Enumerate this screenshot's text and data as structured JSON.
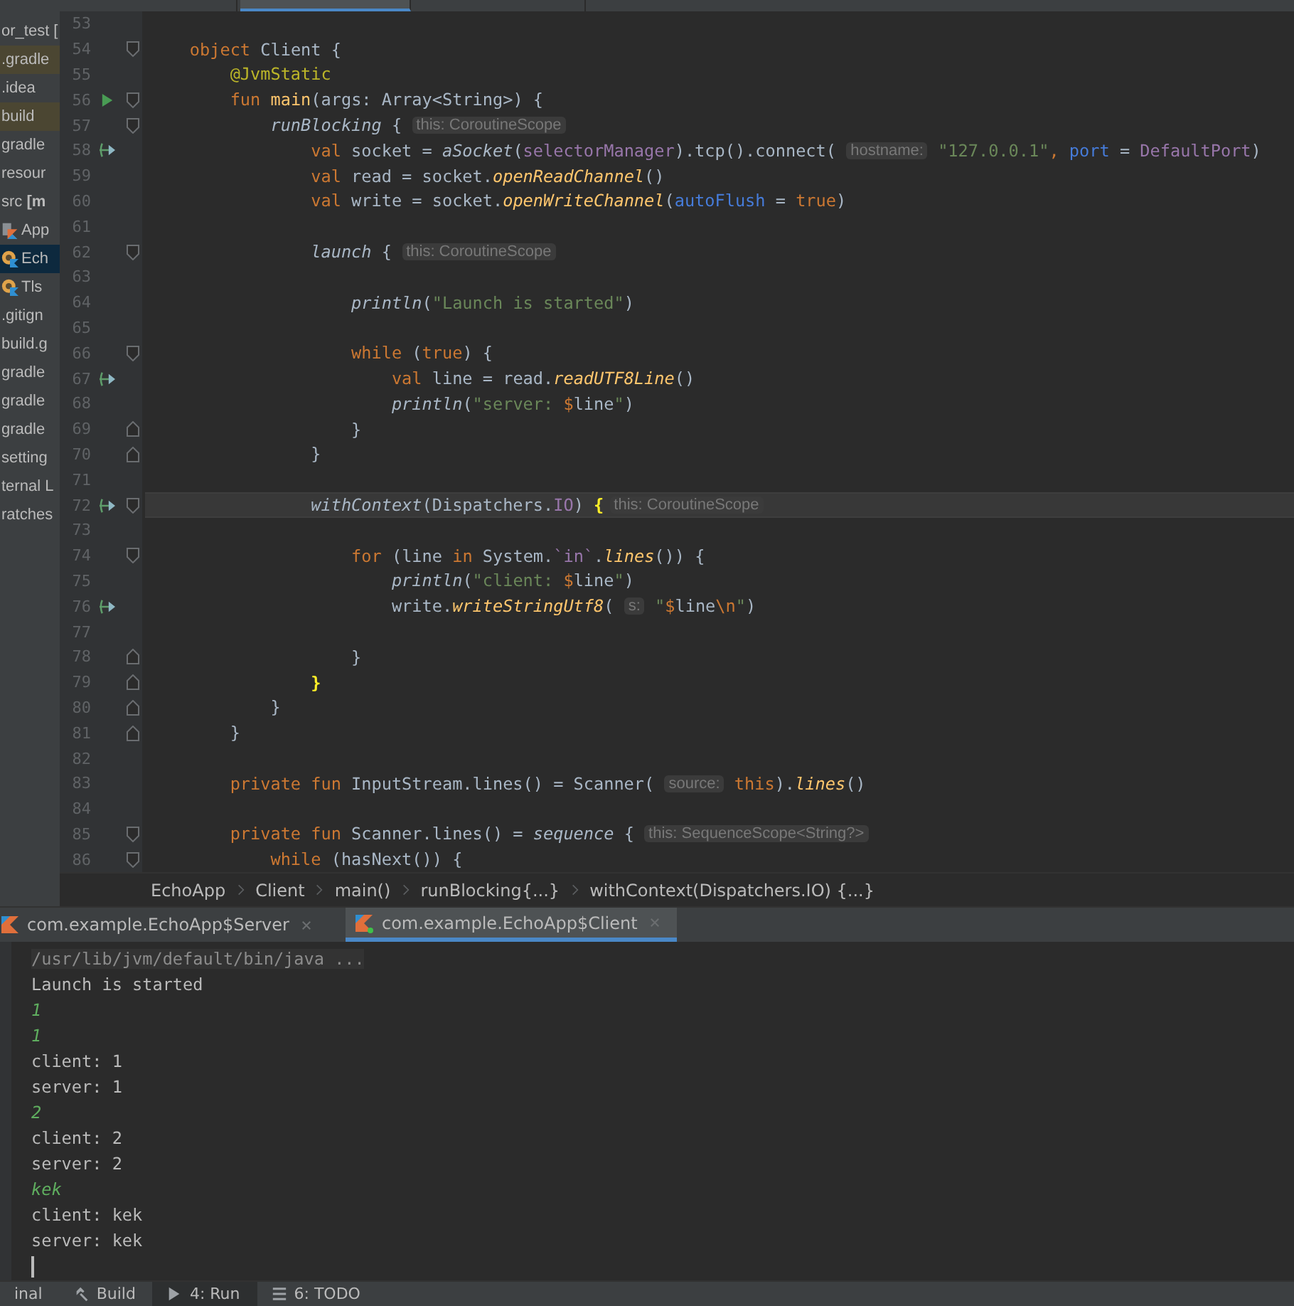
{
  "editor_tabs": [
    {
      "selected": false
    },
    {
      "selected": true
    },
    {
      "selected": false
    }
  ],
  "project_tree": [
    {
      "label": "or_test [",
      "kind": "plain",
      "selected": false,
      "excluded": false
    },
    {
      "label": ".gradle",
      "kind": "plain",
      "selected": false,
      "excluded": true
    },
    {
      "label": ".idea",
      "kind": "plain",
      "selected": false,
      "excluded": false
    },
    {
      "label": "build",
      "kind": "plain",
      "selected": false,
      "excluded": true
    },
    {
      "label": "gradle",
      "kind": "plain",
      "selected": false,
      "excluded": false
    },
    {
      "label": "resour",
      "kind": "plain",
      "selected": false,
      "excluded": false
    },
    {
      "label": "src **[m**",
      "kind": "plain",
      "selected": false,
      "excluded": false
    },
    {
      "label": "App",
      "kind": "kotlin-file",
      "selected": false,
      "excluded": false
    },
    {
      "label": "Ech",
      "kind": "kotlin-object",
      "selected": true,
      "excluded": false
    },
    {
      "label": "Tls",
      "kind": "kotlin-object",
      "selected": false,
      "excluded": false
    },
    {
      "label": ".gitign",
      "kind": "plain",
      "selected": false,
      "excluded": false
    },
    {
      "label": "build.g",
      "kind": "plain",
      "selected": false,
      "excluded": false
    },
    {
      "label": "gradle",
      "kind": "plain",
      "selected": false,
      "excluded": false
    },
    {
      "label": "gradle",
      "kind": "plain",
      "selected": false,
      "excluded": false
    },
    {
      "label": "gradle",
      "kind": "plain",
      "selected": false,
      "excluded": false
    },
    {
      "label": "setting",
      "kind": "plain",
      "selected": false,
      "excluded": false
    },
    {
      "label": "ternal L",
      "kind": "plain",
      "selected": false,
      "excluded": false
    },
    {
      "label": "ratches",
      "kind": "plain",
      "selected": false,
      "excluded": false
    }
  ],
  "code_lines": [
    {
      "number": "53",
      "current": false
    },
    {
      "number": "54",
      "current": false,
      "tokens": [
        {
          "kind": "keyword",
          "text": "    object "
        },
        {
          "kind": "plain",
          "text": "Client {"
        }
      ]
    },
    {
      "number": "55",
      "current": false,
      "tokens": [
        {
          "kind": "annotation",
          "text": "        @JvmStatic"
        }
      ]
    },
    {
      "number": "56",
      "current": false,
      "tokens": [
        {
          "kind": "keyword",
          "text": "        fun "
        },
        {
          "kind": "decl",
          "text": "main"
        },
        {
          "kind": "plain",
          "text": "(args: Array<String>) {"
        }
      ]
    },
    {
      "number": "57",
      "current": false,
      "tokens": [
        {
          "kind": "call",
          "text": "            runBlocking"
        },
        {
          "kind": "plain",
          "text": " { "
        },
        {
          "kind": "hint",
          "text": "this: CoroutineScope"
        }
      ]
    },
    {
      "number": "58",
      "current": false,
      "tokens": [
        {
          "kind": "keyword",
          "text": "                val "
        },
        {
          "kind": "plain",
          "text": "socket = "
        },
        {
          "kind": "call",
          "text": "aSocket"
        },
        {
          "kind": "plain",
          "text": "("
        },
        {
          "kind": "prop",
          "text": "selectorManager"
        },
        {
          "kind": "plain",
          "text": ").tcp().connect( "
        },
        {
          "kind": "hint",
          "text": "hostname:"
        },
        {
          "kind": "string",
          "text": " \"127.0.0.1\""
        },
        {
          "kind": "escape",
          "text": ", "
        },
        {
          "kind": "named",
          "text": "port"
        },
        {
          "kind": "plain",
          "text": " = "
        },
        {
          "kind": "prop",
          "text": "DefaultPort"
        },
        {
          "kind": "plain",
          "text": ")"
        }
      ]
    },
    {
      "number": "59",
      "current": false,
      "tokens": [
        {
          "kind": "keyword",
          "text": "                val "
        },
        {
          "kind": "plain",
          "text": "read = socket."
        },
        {
          "kind": "ext",
          "text": "openReadChannel"
        },
        {
          "kind": "plain",
          "text": "()"
        }
      ]
    },
    {
      "number": "60",
      "current": false,
      "tokens": [
        {
          "kind": "keyword",
          "text": "                val "
        },
        {
          "kind": "plain",
          "text": "write = socket."
        },
        {
          "kind": "ext",
          "text": "openWriteChannel"
        },
        {
          "kind": "plain",
          "text": "("
        },
        {
          "kind": "named",
          "text": "autoFlush"
        },
        {
          "kind": "plain",
          "text": " = "
        },
        {
          "kind": "keyword",
          "text": "true"
        },
        {
          "kind": "plain",
          "text": ")"
        }
      ]
    },
    {
      "number": "61",
      "current": false
    },
    {
      "number": "62",
      "current": false,
      "tokens": [
        {
          "kind": "call",
          "text": "                launch"
        },
        {
          "kind": "plain",
          "text": " { "
        },
        {
          "kind": "hint",
          "text": "this: CoroutineScope"
        }
      ]
    },
    {
      "number": "63",
      "current": false
    },
    {
      "number": "64",
      "current": false,
      "tokens": [
        {
          "kind": "call",
          "text": "                    println"
        },
        {
          "kind": "plain",
          "text": "("
        },
        {
          "kind": "string",
          "text": "\"Launch is started\""
        },
        {
          "kind": "plain",
          "text": ")"
        }
      ]
    },
    {
      "number": "65",
      "current": false
    },
    {
      "number": "66",
      "current": false,
      "tokens": [
        {
          "kind": "keyword",
          "text": "                    while "
        },
        {
          "kind": "plain",
          "text": "("
        },
        {
          "kind": "keyword",
          "text": "true"
        },
        {
          "kind": "plain",
          "text": ") {"
        }
      ]
    },
    {
      "number": "67",
      "current": false,
      "tokens": [
        {
          "kind": "keyword",
          "text": "                        val "
        },
        {
          "kind": "plain",
          "text": "line = read."
        },
        {
          "kind": "ext",
          "text": "readUTF8Line"
        },
        {
          "kind": "plain",
          "text": "()"
        }
      ]
    },
    {
      "number": "68",
      "current": false,
      "tokens": [
        {
          "kind": "call",
          "text": "                        println"
        },
        {
          "kind": "plain",
          "text": "("
        },
        {
          "kind": "string",
          "text": "\"server: "
        },
        {
          "kind": "escape",
          "text": "$"
        },
        {
          "kind": "plain",
          "text": "line"
        },
        {
          "kind": "string",
          "text": "\""
        },
        {
          "kind": "plain",
          "text": ")"
        }
      ]
    },
    {
      "number": "69",
      "current": false,
      "tokens": [
        {
          "kind": "plain",
          "text": "                    }"
        }
      ]
    },
    {
      "number": "70",
      "current": false,
      "tokens": [
        {
          "kind": "plain",
          "text": "                }"
        }
      ]
    },
    {
      "number": "71",
      "current": false
    },
    {
      "number": "72",
      "current": true,
      "tokens": [
        {
          "kind": "call",
          "text": "                withContext"
        },
        {
          "kind": "plain",
          "text": "(Dispatchers."
        },
        {
          "kind": "prop",
          "text": "IO"
        },
        {
          "kind": "plain",
          "text": ") "
        },
        {
          "kind": "match",
          "text": "{"
        },
        {
          "kind": "hint",
          "text": "this: CoroutineScope"
        }
      ]
    },
    {
      "number": "73",
      "current": false
    },
    {
      "number": "74",
      "current": false,
      "tokens": [
        {
          "kind": "keyword",
          "text": "                    for "
        },
        {
          "kind": "plain",
          "text": "(line "
        },
        {
          "kind": "keyword",
          "text": "in "
        },
        {
          "kind": "plain",
          "text": "System."
        },
        {
          "kind": "prop",
          "text": "`in`"
        },
        {
          "kind": "plain",
          "text": "."
        },
        {
          "kind": "ext",
          "text": "lines"
        },
        {
          "kind": "plain",
          "text": "()) {"
        }
      ]
    },
    {
      "number": "75",
      "current": false,
      "tokens": [
        {
          "kind": "call",
          "text": "                        println"
        },
        {
          "kind": "plain",
          "text": "("
        },
        {
          "kind": "string",
          "text": "\"client: "
        },
        {
          "kind": "escape",
          "text": "$"
        },
        {
          "kind": "plain",
          "text": "line"
        },
        {
          "kind": "string",
          "text": "\""
        },
        {
          "kind": "plain",
          "text": ")"
        }
      ]
    },
    {
      "number": "76",
      "current": false,
      "tokens": [
        {
          "kind": "plain",
          "text": "                        write."
        },
        {
          "kind": "ext",
          "text": "writeStringUtf8"
        },
        {
          "kind": "plain",
          "text": "( "
        },
        {
          "kind": "hint",
          "text": "s:"
        },
        {
          "kind": "string",
          "text": " \""
        },
        {
          "kind": "escape",
          "text": "$"
        },
        {
          "kind": "plain",
          "text": "line"
        },
        {
          "kind": "escape",
          "text": "\\n"
        },
        {
          "kind": "string",
          "text": "\""
        },
        {
          "kind": "plain",
          "text": ")"
        }
      ]
    },
    {
      "number": "77",
      "current": false
    },
    {
      "number": "78",
      "current": false,
      "tokens": [
        {
          "kind": "plain",
          "text": "                    }"
        }
      ]
    },
    {
      "number": "79",
      "current": false,
      "tokens": [
        {
          "kind": "match",
          "text": "                }"
        }
      ]
    },
    {
      "number": "80",
      "current": false,
      "tokens": [
        {
          "kind": "plain",
          "text": "            }"
        }
      ]
    },
    {
      "number": "81",
      "current": false,
      "tokens": [
        {
          "kind": "plain",
          "text": "        }"
        }
      ]
    },
    {
      "number": "82",
      "current": false
    },
    {
      "number": "83",
      "current": false,
      "tokens": [
        {
          "kind": "keyword",
          "text": "        private fun "
        },
        {
          "kind": "plain",
          "text": "InputStream.lines() = Scanner( "
        },
        {
          "kind": "hint",
          "text": "source:"
        },
        {
          "kind": "keyword",
          "text": " this"
        },
        {
          "kind": "plain",
          "text": ")."
        },
        {
          "kind": "ext",
          "text": "lines"
        },
        {
          "kind": "plain",
          "text": "()"
        }
      ]
    },
    {
      "number": "84",
      "current": false
    },
    {
      "number": "85",
      "current": false,
      "tokens": [
        {
          "kind": "keyword",
          "text": "        private fun "
        },
        {
          "kind": "plain",
          "text": "Scanner.lines() = "
        },
        {
          "kind": "call",
          "text": "sequence"
        },
        {
          "kind": "plain",
          "text": " { "
        },
        {
          "kind": "hint",
          "text": "this: SequenceScope<String?>"
        }
      ]
    },
    {
      "number": "86",
      "current": false,
      "tokens": [
        {
          "kind": "keyword",
          "text": "            while "
        },
        {
          "kind": "plain",
          "text": "(hasNext()) {"
        }
      ]
    }
  ],
  "breadcrumbs": [
    "EchoApp",
    "Client",
    "main()",
    "runBlocking{...}",
    "withContext(Dispatchers.IO) {...}"
  ],
  "run_tabs": [
    {
      "label": "com.example.EchoApp$Server",
      "selected": false
    },
    {
      "label": "com.example.EchoApp$Client",
      "selected": true
    }
  ],
  "console": [
    {
      "kind": "command",
      "text": "/usr/lib/jvm/default/bin/java ..."
    },
    {
      "kind": "output",
      "text": "Launch is started"
    },
    {
      "kind": "input",
      "text": "1"
    },
    {
      "kind": "input",
      "text": "1"
    },
    {
      "kind": "output",
      "text": "client: 1"
    },
    {
      "kind": "output",
      "text": "server: 1"
    },
    {
      "kind": "input",
      "text": "2"
    },
    {
      "kind": "output",
      "text": "client: 2"
    },
    {
      "kind": "output",
      "text": "server: 2"
    },
    {
      "kind": "input",
      "text": "kek"
    },
    {
      "kind": "output",
      "text": "client: kek"
    },
    {
      "kind": "output",
      "text": "server: kek"
    }
  ],
  "tool_buttons": [
    {
      "label": "inal",
      "selected": false
    },
    {
      "label": "Build",
      "selected": false
    },
    {
      "label": "4: Run",
      "selected": true
    },
    {
      "label": "6: TODO",
      "selected": false
    }
  ]
}
